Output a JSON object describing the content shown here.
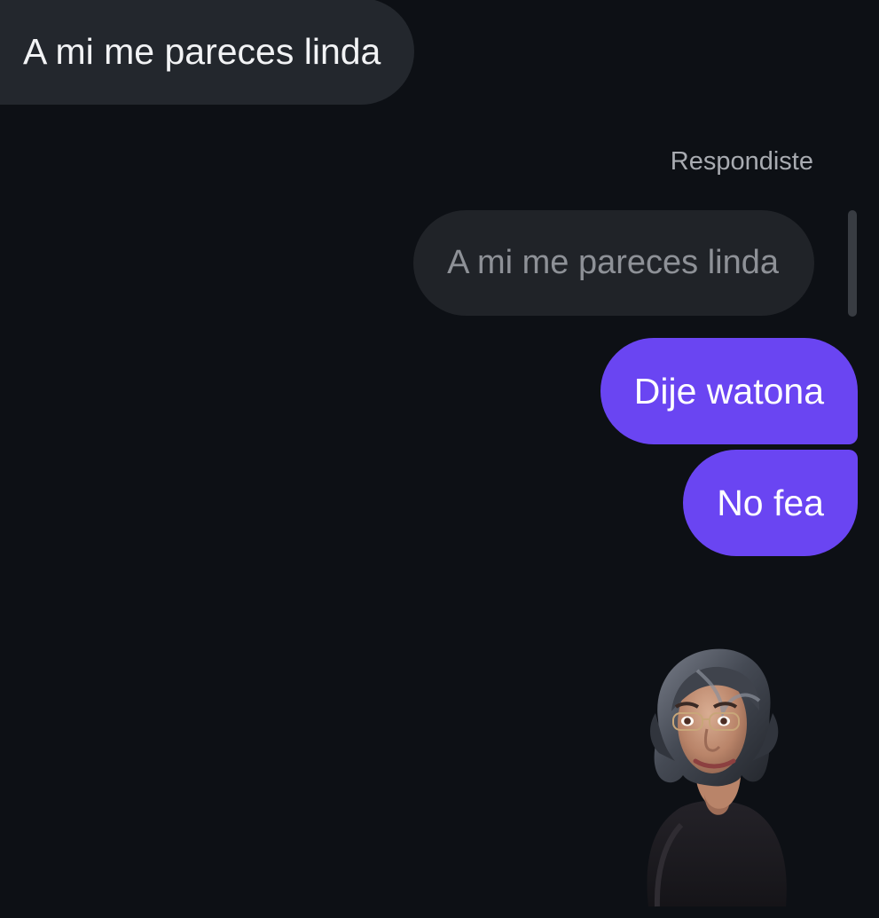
{
  "messages": {
    "incoming_text": "A mi me pareces linda",
    "reply_label": "Respondiste",
    "reply_quote_text": "A mi me pareces linda",
    "outgoing": [
      "Dije watona",
      "No fea"
    ]
  },
  "colors": {
    "background": "#0d1015",
    "incoming_bubble": "#23272d",
    "quote_bubble": "#202328",
    "outgoing_bubble": "#6a45f2",
    "text_light": "#ffffff",
    "text_muted": "#a8abb1"
  },
  "avatar": {
    "icon": "user-avatar-icon"
  }
}
